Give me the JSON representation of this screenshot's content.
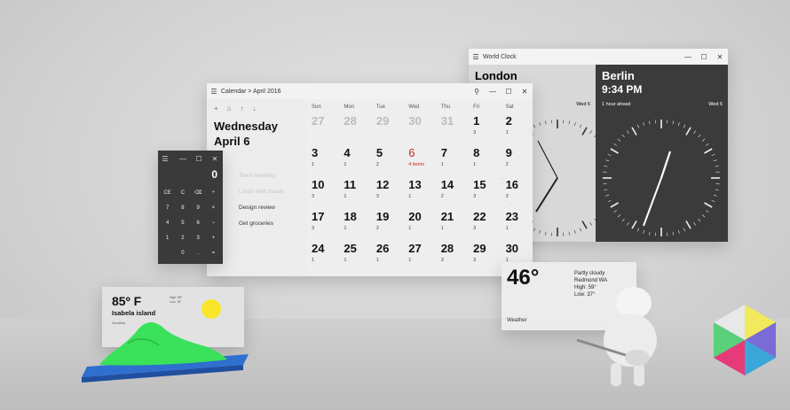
{
  "calendar": {
    "title": "Calendar > April 2016",
    "tools": [
      "+",
      "⌂",
      "↑",
      "↓"
    ],
    "weekday": "Wednesday",
    "date": "April 6",
    "events": [
      {
        "label": "Team meeting",
        "faded": true
      },
      {
        "label": "Lunch with Sarah",
        "faded": true
      },
      {
        "label": "Design review",
        "faded": false
      },
      {
        "label": "Get groceries",
        "faded": false
      }
    ],
    "headers": [
      "Sun",
      "Mon",
      "Tue",
      "Wed",
      "Thu",
      "Fri",
      "Sat"
    ],
    "weeks": [
      [
        {
          "n": "27",
          "c": "",
          "m": true
        },
        {
          "n": "28",
          "c": "",
          "m": true
        },
        {
          "n": "29",
          "c": "",
          "m": true
        },
        {
          "n": "30",
          "c": "",
          "m": true
        },
        {
          "n": "31",
          "c": "",
          "m": true
        },
        {
          "n": "1",
          "c": "3"
        },
        {
          "n": "2",
          "c": "1"
        }
      ],
      [
        {
          "n": "3",
          "c": "1"
        },
        {
          "n": "4",
          "c": "1"
        },
        {
          "n": "5",
          "c": "2"
        },
        {
          "n": "6",
          "c": "4 items",
          "t": true
        },
        {
          "n": "7",
          "c": "1"
        },
        {
          "n": "8",
          "c": "1"
        },
        {
          "n": "9",
          "c": "2"
        }
      ],
      [
        {
          "n": "10",
          "c": "3"
        },
        {
          "n": "11",
          "c": "1"
        },
        {
          "n": "12",
          "c": "3"
        },
        {
          "n": "13",
          "c": "1"
        },
        {
          "n": "14",
          "c": "2"
        },
        {
          "n": "15",
          "c": "3"
        },
        {
          "n": "16",
          "c": "3"
        }
      ],
      [
        {
          "n": "17",
          "c": "3"
        },
        {
          "n": "18",
          "c": "1"
        },
        {
          "n": "19",
          "c": "2"
        },
        {
          "n": "20",
          "c": "1"
        },
        {
          "n": "21",
          "c": "1"
        },
        {
          "n": "22",
          "c": "3"
        },
        {
          "n": "23",
          "c": "1"
        }
      ],
      [
        {
          "n": "24",
          "c": "1"
        },
        {
          "n": "25",
          "c": "1"
        },
        {
          "n": "26",
          "c": "1"
        },
        {
          "n": "27",
          "c": "1"
        },
        {
          "n": "28",
          "c": "3"
        },
        {
          "n": "29",
          "c": "3"
        },
        {
          "n": "30",
          "c": "1"
        }
      ]
    ]
  },
  "calculator": {
    "display": "0",
    "keys": [
      "CE",
      "C",
      "⌫",
      "÷",
      "7",
      "8",
      "9",
      "×",
      "4",
      "5",
      "6",
      "−",
      "1",
      "2",
      "3",
      "+",
      "",
      "0",
      ".",
      "="
    ]
  },
  "clock": {
    "title": "World Clock",
    "left": {
      "city": "London",
      "day": "Wed 6"
    },
    "right": {
      "city": "Berlin",
      "time": "9:34 PM",
      "note": "1 hour ahead",
      "day": "Wed 6"
    }
  },
  "weather": {
    "temp": "46°",
    "lines": [
      "Partly cloudy",
      "Redmond WA",
      "High: 59°",
      "Low: 37°"
    ],
    "label": "Weather"
  },
  "weather_tile": {
    "temp": "85º F",
    "place": "Isabela island",
    "meta": [
      "High: 88°",
      "Low: 76°"
    ],
    "condition": "Cloudless"
  },
  "colors": {
    "today": "#c62828",
    "clock_dark": "#3b3b3b",
    "sun": "#f7e62a",
    "island": "#39e25a",
    "water": "#2f6fd0"
  },
  "icons": [
    "hamburger-icon",
    "search-icon",
    "minimize-icon",
    "maximize-icon",
    "close-icon",
    "sun-icon",
    "island-icon",
    "cube-icon",
    "guitar-character-icon"
  ]
}
